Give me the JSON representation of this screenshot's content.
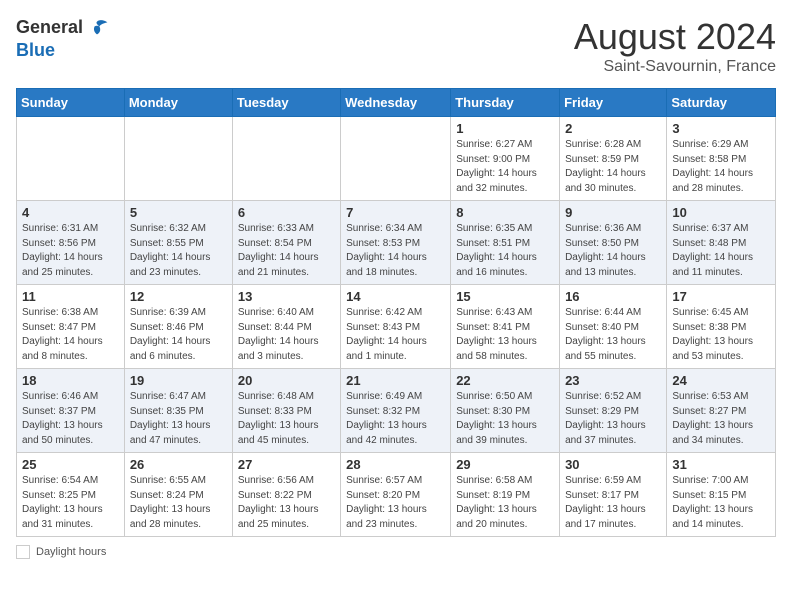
{
  "header": {
    "logo_general": "General",
    "logo_blue": "Blue",
    "month_year": "August 2024",
    "location": "Saint-Savournin, France"
  },
  "days_of_week": [
    "Sunday",
    "Monday",
    "Tuesday",
    "Wednesday",
    "Thursday",
    "Friday",
    "Saturday"
  ],
  "weeks": [
    {
      "days": [
        {
          "num": "",
          "info": ""
        },
        {
          "num": "",
          "info": ""
        },
        {
          "num": "",
          "info": ""
        },
        {
          "num": "",
          "info": ""
        },
        {
          "num": "1",
          "info": "Sunrise: 6:27 AM\nSunset: 9:00 PM\nDaylight: 14 hours\nand 32 minutes."
        },
        {
          "num": "2",
          "info": "Sunrise: 6:28 AM\nSunset: 8:59 PM\nDaylight: 14 hours\nand 30 minutes."
        },
        {
          "num": "3",
          "info": "Sunrise: 6:29 AM\nSunset: 8:58 PM\nDaylight: 14 hours\nand 28 minutes."
        }
      ]
    },
    {
      "days": [
        {
          "num": "4",
          "info": "Sunrise: 6:31 AM\nSunset: 8:56 PM\nDaylight: 14 hours\nand 25 minutes."
        },
        {
          "num": "5",
          "info": "Sunrise: 6:32 AM\nSunset: 8:55 PM\nDaylight: 14 hours\nand 23 minutes."
        },
        {
          "num": "6",
          "info": "Sunrise: 6:33 AM\nSunset: 8:54 PM\nDaylight: 14 hours\nand 21 minutes."
        },
        {
          "num": "7",
          "info": "Sunrise: 6:34 AM\nSunset: 8:53 PM\nDaylight: 14 hours\nand 18 minutes."
        },
        {
          "num": "8",
          "info": "Sunrise: 6:35 AM\nSunset: 8:51 PM\nDaylight: 14 hours\nand 16 minutes."
        },
        {
          "num": "9",
          "info": "Sunrise: 6:36 AM\nSunset: 8:50 PM\nDaylight: 14 hours\nand 13 minutes."
        },
        {
          "num": "10",
          "info": "Sunrise: 6:37 AM\nSunset: 8:48 PM\nDaylight: 14 hours\nand 11 minutes."
        }
      ]
    },
    {
      "days": [
        {
          "num": "11",
          "info": "Sunrise: 6:38 AM\nSunset: 8:47 PM\nDaylight: 14 hours\nand 8 minutes."
        },
        {
          "num": "12",
          "info": "Sunrise: 6:39 AM\nSunset: 8:46 PM\nDaylight: 14 hours\nand 6 minutes."
        },
        {
          "num": "13",
          "info": "Sunrise: 6:40 AM\nSunset: 8:44 PM\nDaylight: 14 hours\nand 3 minutes."
        },
        {
          "num": "14",
          "info": "Sunrise: 6:42 AM\nSunset: 8:43 PM\nDaylight: 14 hours\nand 1 minute."
        },
        {
          "num": "15",
          "info": "Sunrise: 6:43 AM\nSunset: 8:41 PM\nDaylight: 13 hours\nand 58 minutes."
        },
        {
          "num": "16",
          "info": "Sunrise: 6:44 AM\nSunset: 8:40 PM\nDaylight: 13 hours\nand 55 minutes."
        },
        {
          "num": "17",
          "info": "Sunrise: 6:45 AM\nSunset: 8:38 PM\nDaylight: 13 hours\nand 53 minutes."
        }
      ]
    },
    {
      "days": [
        {
          "num": "18",
          "info": "Sunrise: 6:46 AM\nSunset: 8:37 PM\nDaylight: 13 hours\nand 50 minutes."
        },
        {
          "num": "19",
          "info": "Sunrise: 6:47 AM\nSunset: 8:35 PM\nDaylight: 13 hours\nand 47 minutes."
        },
        {
          "num": "20",
          "info": "Sunrise: 6:48 AM\nSunset: 8:33 PM\nDaylight: 13 hours\nand 45 minutes."
        },
        {
          "num": "21",
          "info": "Sunrise: 6:49 AM\nSunset: 8:32 PM\nDaylight: 13 hours\nand 42 minutes."
        },
        {
          "num": "22",
          "info": "Sunrise: 6:50 AM\nSunset: 8:30 PM\nDaylight: 13 hours\nand 39 minutes."
        },
        {
          "num": "23",
          "info": "Sunrise: 6:52 AM\nSunset: 8:29 PM\nDaylight: 13 hours\nand 37 minutes."
        },
        {
          "num": "24",
          "info": "Sunrise: 6:53 AM\nSunset: 8:27 PM\nDaylight: 13 hours\nand 34 minutes."
        }
      ]
    },
    {
      "days": [
        {
          "num": "25",
          "info": "Sunrise: 6:54 AM\nSunset: 8:25 PM\nDaylight: 13 hours\nand 31 minutes."
        },
        {
          "num": "26",
          "info": "Sunrise: 6:55 AM\nSunset: 8:24 PM\nDaylight: 13 hours\nand 28 minutes."
        },
        {
          "num": "27",
          "info": "Sunrise: 6:56 AM\nSunset: 8:22 PM\nDaylight: 13 hours\nand 25 minutes."
        },
        {
          "num": "28",
          "info": "Sunrise: 6:57 AM\nSunset: 8:20 PM\nDaylight: 13 hours\nand 23 minutes."
        },
        {
          "num": "29",
          "info": "Sunrise: 6:58 AM\nSunset: 8:19 PM\nDaylight: 13 hours\nand 20 minutes."
        },
        {
          "num": "30",
          "info": "Sunrise: 6:59 AM\nSunset: 8:17 PM\nDaylight: 13 hours\nand 17 minutes."
        },
        {
          "num": "31",
          "info": "Sunrise: 7:00 AM\nSunset: 8:15 PM\nDaylight: 13 hours\nand 14 minutes."
        }
      ]
    }
  ],
  "legend": {
    "label": "Daylight hours"
  }
}
